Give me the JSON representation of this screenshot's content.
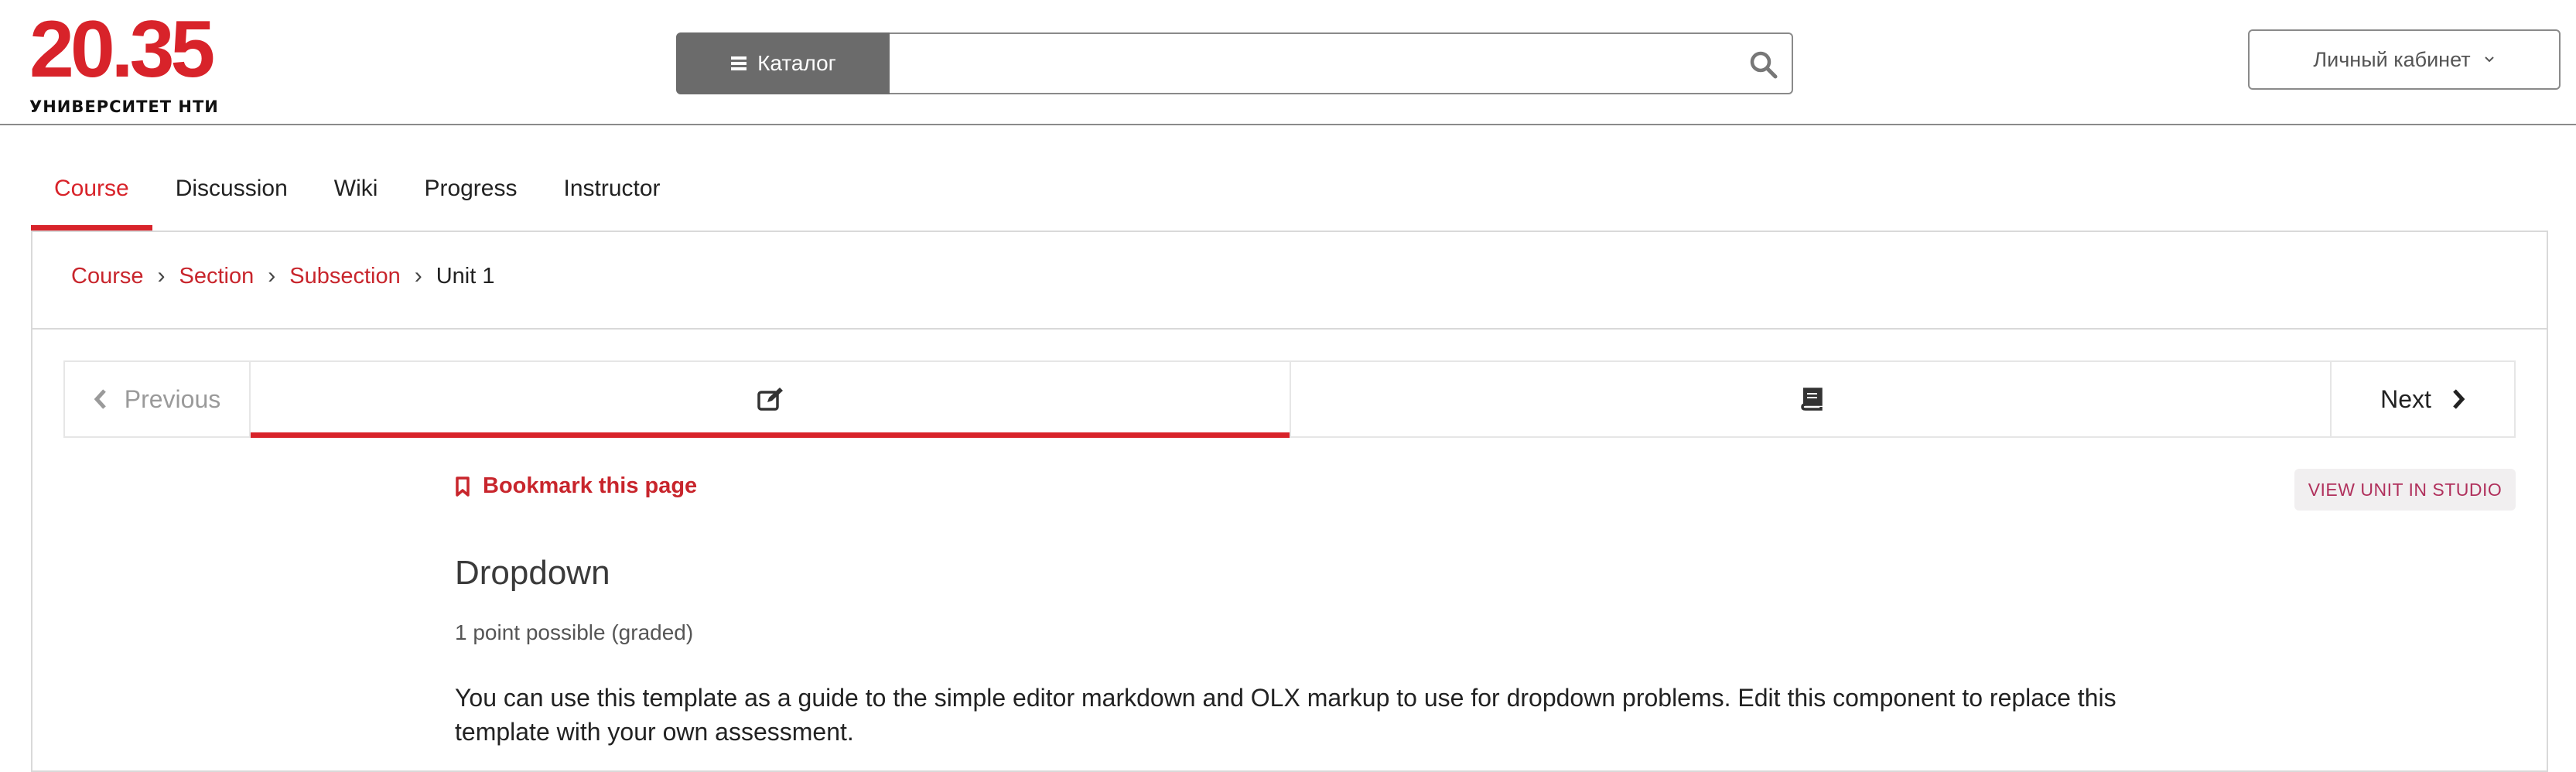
{
  "header": {
    "logo_number": "20.35",
    "logo_subtitle": "УНИВЕРСИТЕТ НТИ",
    "catalog_label": "Каталог",
    "search_placeholder": "",
    "account_label": "Личный кабинет"
  },
  "tabs": [
    {
      "label": "Course",
      "active": true
    },
    {
      "label": "Discussion",
      "active": false
    },
    {
      "label": "Wiki",
      "active": false
    },
    {
      "label": "Progress",
      "active": false
    },
    {
      "label": "Instructor",
      "active": false
    }
  ],
  "breadcrumb": {
    "items": [
      "Course",
      "Section",
      "Subsection"
    ],
    "current": "Unit 1"
  },
  "sequence": {
    "previous_label": "Previous",
    "next_label": "Next",
    "units": [
      {
        "icon": "edit-icon",
        "active": true
      },
      {
        "icon": "book-icon",
        "active": false
      }
    ]
  },
  "unit": {
    "bookmark_label": "Bookmark this page",
    "studio_label": "VIEW UNIT IN STUDIO",
    "problem_title": "Dropdown",
    "problem_points": "1 point possible (graded)",
    "problem_text": "You can use this template as a guide to the simple editor markdown and OLX markup to use for dropdown problems. Edit this component to replace this template with your own assessment."
  },
  "colors": {
    "brand_red": "#d8232a",
    "link_red": "#c8252c",
    "catalog_gray": "#6b6b6b",
    "studio_text": "#b0305c"
  }
}
